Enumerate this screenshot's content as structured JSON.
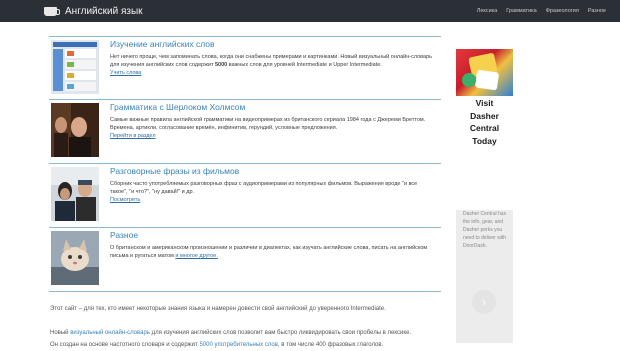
{
  "navbar": {
    "brand": "Английский язык",
    "links": [
      "Лексика",
      "Грамматика",
      "Фразеология",
      "Разное"
    ]
  },
  "items": [
    {
      "title": "Изучение английских слов",
      "desc_start": "Нет ничего проще, чем запоминать слова, когда они снабжены примерами и картинками. Новый визуальный онлайн-словарь для изучения английских слов содержит ",
      "desc_bold": "5000",
      "desc_end": " важных слов для уровней Intermediate и Upper Intermediate.",
      "link": "Учить слова"
    },
    {
      "title": "Грамматика с Шерлоком Холмсом",
      "desc": "Самые важные правила английской грамматики на видеопримерах из британского сериала 1984 года с Джереми Бреттом. Времена, артикли, согласование времён, инфинитив, герундий, условные предложения.",
      "link": "Перейти в раздел"
    },
    {
      "title": "Разговорные фразы из фильмов",
      "desc": "Сборник часто употребляемых разговорных фраз с аудиопримерами из популярных фильмов. Выражения вроде \"и все такое\", \"и что?\", \"ну давай!\" и др.",
      "link": "Посмотреть"
    },
    {
      "title": "Разное",
      "desc": "О британском и американском произношении и различии в диалектах, как изучать английские слова, писать на английском письма и ругаться матом ",
      "link": "и многое другое."
    }
  ],
  "intro": {
    "p1": "Этот сайт – для тех, кто имеет некоторые знания языка и намерен довести свой английский до уверенного Intermediate.",
    "p2_start": "Новый ",
    "p2_link": "визуальный онлайн-словарь",
    "p2_end": " для изучения английских слов позволит вам быстро ликвидировать свои пробелы в лексике.",
    "p3_start": "Он создан на основе частотного словаря и содержит ",
    "p3_link": "5000 употребительных слов",
    "p3_end": ", в том числе 400 фразовых глаголов."
  },
  "ad": {
    "line1": "Visit",
    "line2": "Dasher",
    "line3": "Central",
    "line4": "Today",
    "body": "Dasher Central has the info, gear, and Dasher perks you need to deliver with DoorDash.",
    "button": "›"
  }
}
